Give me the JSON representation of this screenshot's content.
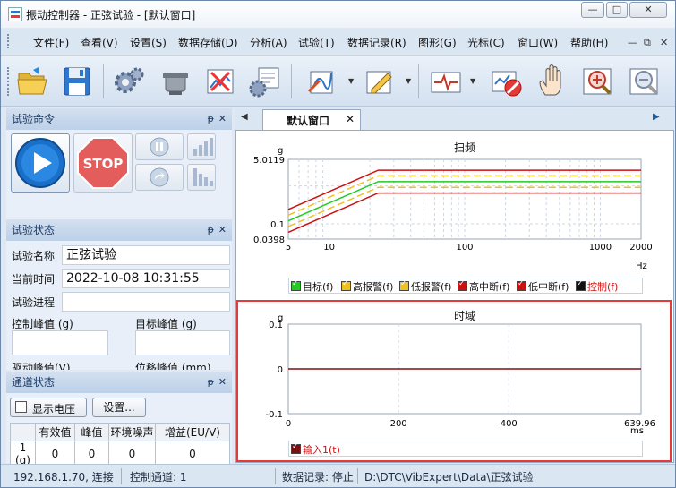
{
  "window": {
    "title": "振动控制器 - 正弦试验 - [默认窗口]",
    "btn_min": "—",
    "btn_max": "□",
    "btn_close": "✕"
  },
  "menu": [
    "文件(F)",
    "查看(V)",
    "设置(S)",
    "数据存储(D)",
    "分析(A)",
    "试验(T)",
    "数据记录(R)",
    "图形(G)",
    "光标(C)",
    "窗口(W)",
    "帮助(H)"
  ],
  "mdi_controls": {
    "min": "—",
    "restore": "⧉",
    "close": "✕"
  },
  "panels": {
    "test_command": {
      "title": "试验命令",
      "pin": "ᵽ",
      "close": "✕",
      "stop_label": "STOP"
    },
    "test_status": {
      "title": "试验状态",
      "pin": "ᵽ",
      "close": "✕",
      "name_label": "试验名称",
      "name_value": "正弦试验",
      "time_label": "当前时间",
      "time_value": "2022-10-08 10:31:55",
      "progress_label": "试验进程",
      "ctrl_peak_label": "控制峰值 (g)",
      "target_peak_label": "目标峰值 (g)",
      "drive_peak_label": "驱动峰值(V)",
      "disp_peak_label": "位移峰值 (mm)"
    },
    "channel_status": {
      "title": "通道状态",
      "pin": "ᵽ",
      "close": "✕",
      "show_voltage": "显示电压",
      "settings_button": "设置...",
      "columns": [
        "",
        "有效值",
        "峰值",
        "环境噪声",
        "增益(EU/V)"
      ],
      "rows": [
        [
          "1 (g)",
          "0",
          "0",
          "0",
          "0"
        ]
      ]
    }
  },
  "tabs": {
    "active": "默认窗口",
    "close": "✕",
    "left_arrow": "◀",
    "right_arrow": "▶"
  },
  "sweep_chart": {
    "title": "扫频",
    "y_unit": "g",
    "x_unit": "Hz",
    "y_ticks": [
      "5.0119",
      "0.1",
      "0.0398"
    ],
    "x_ticks": [
      "5",
      "10",
      "100",
      "1000",
      "2000"
    ],
    "legend": [
      "目标(f)",
      "高报警(f)",
      "低报警(f)",
      "高中断(f)",
      "低中断(f)",
      "控制(f)"
    ]
  },
  "time_chart": {
    "title": "时域",
    "y_unit": "g",
    "x_unit": "ms",
    "y_ticks": [
      "0.1",
      "0",
      "-0.1"
    ],
    "x_ticks": [
      "0",
      "200",
      "400",
      "639.96"
    ],
    "legend": [
      "输入1(t)"
    ]
  },
  "status_bar": {
    "ip": "192.168.1.70, 连接",
    "control_channel": "控制通道: 1",
    "data_record": "数据记录: 停止",
    "path": "D:\\DTC\\VibExpert\\Data\\正弦试验"
  },
  "colors": {
    "target": "#22cc22",
    "high_alarm": "#f0c020",
    "low_alarm": "#f0c020",
    "high_abort": "#cc1111",
    "low_abort": "#cc1111",
    "control": "#111111",
    "input": "#7a1010",
    "highlight": "#e03c3c"
  },
  "chart_data": [
    {
      "type": "line",
      "title": "扫频",
      "xscale": "log",
      "xlim": [
        5,
        2000
      ],
      "ylim": [
        0.0398,
        5.0119
      ],
      "xlabel": "Hz",
      "ylabel": "g",
      "series": [
        {
          "name": "目标(f)",
          "x": [
            5,
            23,
            2000
          ],
          "y": [
            0.12,
            1.3,
            1.3
          ]
        },
        {
          "name": "高报警(f)",
          "x": [
            5,
            23,
            2000
          ],
          "y": [
            0.17,
            1.85,
            1.85
          ]
        },
        {
          "name": "低报警(f)",
          "x": [
            5,
            23,
            2000
          ],
          "y": [
            0.085,
            0.92,
            0.92
          ]
        },
        {
          "name": "高中断(f)",
          "x": [
            5,
            23,
            2000
          ],
          "y": [
            0.24,
            2.6,
            2.6
          ]
        },
        {
          "name": "低中断(f)",
          "x": [
            5,
            23,
            2000
          ],
          "y": [
            0.06,
            0.65,
            0.65
          ]
        }
      ]
    },
    {
      "type": "line",
      "title": "时域",
      "xlim": [
        0,
        639.96
      ],
      "ylim": [
        -0.1,
        0.1
      ],
      "xlabel": "ms",
      "ylabel": "g",
      "series": [
        {
          "name": "输入1(t)",
          "x": [
            0,
            639.96
          ],
          "y": [
            0,
            0
          ]
        }
      ]
    }
  ]
}
